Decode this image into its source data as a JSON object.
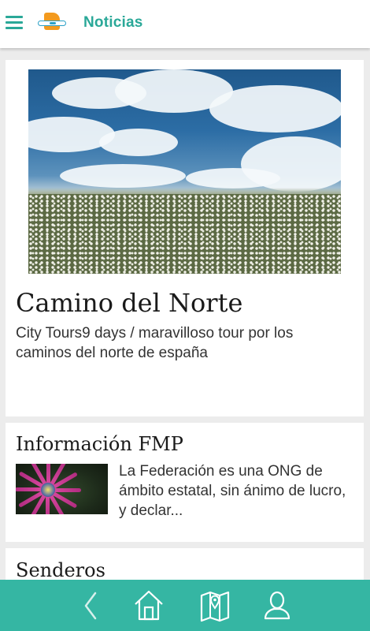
{
  "header": {
    "title": "Noticias",
    "menu_icon": "hamburger-menu-icon",
    "logo": "app-logo"
  },
  "cards": [
    {
      "title": "Camino del Norte",
      "description": "City Tours9 days / maravilloso tour por los caminos del norte de españa",
      "image": "flower-field-sky-image"
    },
    {
      "title": "Información FMP",
      "description": "La Federación es una ONG de ámbito estatal, sin ánimo de lucro, y declar...",
      "image": "purple-flower-thumbnail"
    },
    {
      "title": "Senderos"
    }
  ],
  "bottom_nav": {
    "items": [
      {
        "icon": "back-chevron-icon"
      },
      {
        "icon": "home-icon"
      },
      {
        "icon": "map-pin-icon"
      },
      {
        "icon": "user-icon"
      }
    ]
  },
  "colors": {
    "accent": "#2aa898",
    "bottom_bar": "#35b6a3",
    "background": "#ececec",
    "logo_orange": "#f39a1e"
  }
}
